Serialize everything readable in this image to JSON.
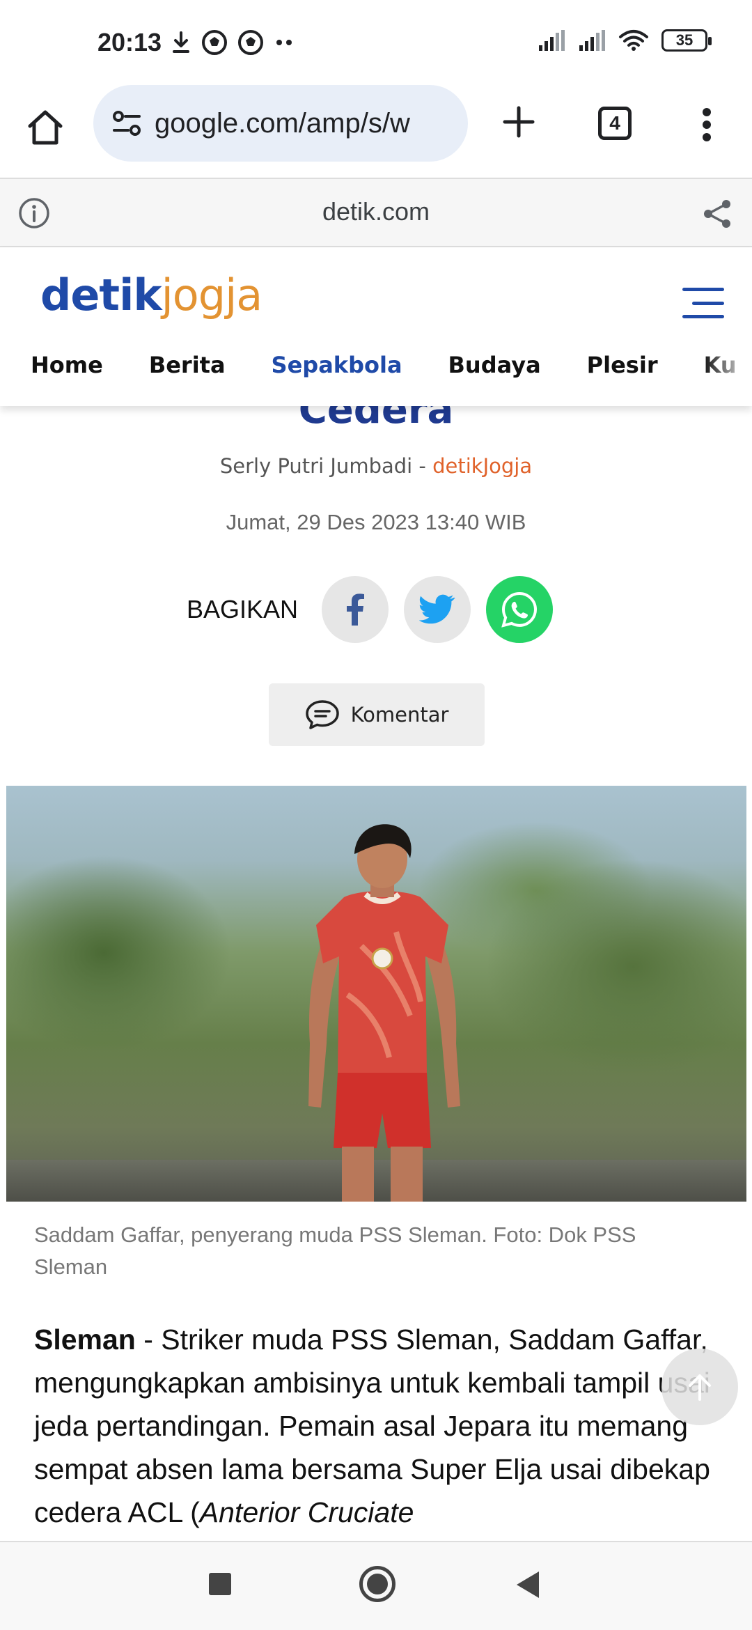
{
  "status_bar": {
    "time": "20:13",
    "battery": "35",
    "icons_left": [
      "download-icon",
      "soccer-ball-icon",
      "soccer-ball-icon",
      "more-dots-icon"
    ],
    "icons_right": [
      "signal-icon",
      "signal-icon",
      "wifi-icon",
      "battery-icon"
    ]
  },
  "browser": {
    "url": "google.com/amp/s/w",
    "tab_count": "4",
    "icons": [
      "home-icon",
      "site-settings-icon",
      "plus-icon",
      "tabs-icon",
      "more-vert-icon"
    ]
  },
  "amp_bar": {
    "domain": "detik.com",
    "icons": [
      "info-icon",
      "share-icon"
    ]
  },
  "site": {
    "logo_part1": "detik",
    "logo_part2": "jogja",
    "brand_blue": "#1f4aa8",
    "brand_orange": "#e39332",
    "nav": [
      {
        "label": "Home",
        "active": false
      },
      {
        "label": "Berita",
        "active": false
      },
      {
        "label": "Sepakbola",
        "active": true
      },
      {
        "label": "Budaya",
        "active": false
      },
      {
        "label": "Plesir",
        "active": false
      },
      {
        "label": "Ku",
        "active": false
      }
    ]
  },
  "article": {
    "title_fragment": "Cedera",
    "author": "Serly Putri Jumbadi",
    "byline_sep": " - ",
    "source": "detikJogja",
    "date": "Jumat, 29 Des 2023 13:40 WIB",
    "share_label": "BAGIKAN",
    "share_icons": [
      "facebook-icon",
      "twitter-icon",
      "whatsapp-icon"
    ],
    "comment_label": "Komentar",
    "photo_caption": "Saddam Gaffar, penyerang muda PSS Sleman. Foto: Dok PSS Sleman",
    "body_lead": "Sleman",
    "body_text": " - Striker muda PSS Sleman, Saddam Gaffar, mengungkapkan ambisinya untuk kembali tampil usai jeda pertandingan. Pemain asal Jepara itu memang sempat absen lama bersama Super Elja usai dibekap cedera ACL (",
    "body_italic": "Anterior Cruciate"
  },
  "android_nav": {
    "icons": [
      "recents-icon",
      "home-circle-icon",
      "back-icon"
    ]
  }
}
